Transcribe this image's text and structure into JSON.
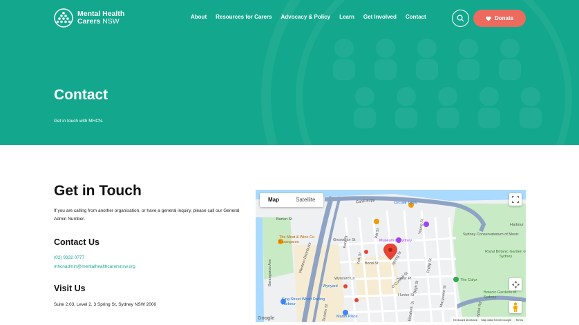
{
  "header": {
    "logo_line1": "Mental Health",
    "logo_line2": "Carers",
    "logo_line2b": "NSW",
    "nav": [
      "About",
      "Resources for Carers",
      "Advocacy & Policy",
      "Learn",
      "Get Involved",
      "Contact"
    ],
    "donate_label": "Donate",
    "search_icon": "search-icon",
    "donate_icon": "heart-icon"
  },
  "hero": {
    "title": "Contact",
    "subtitle": "Get in touch with MHCN."
  },
  "content": {
    "heading": "Get in Touch",
    "intro": "If you are calling from another organisation, or have a general inquiry, please call our General Admin Number.",
    "contact_heading": "Contact Us",
    "phone": "(02) 9332 0777",
    "email": "mhcnadmin@mentalhealthcarersnsw.org",
    "visit_heading": "Visit Us",
    "address": "Suite 2.03, Level 2, 3 Spring St, Sydney NSW 2000"
  },
  "map": {
    "tab_map": "Map",
    "tab_satellite": "Satellite",
    "labels": [
      "Cahill Expy",
      "Circular Quay",
      "Grosvenor St",
      "Bond St",
      "Wynyard",
      "Martin Place",
      "Museum of Sydney",
      "Sydney Conservatorium of Music",
      "Royal Botanic Garden of Sydney",
      "The Calyx",
      "Botanic Gardens of Sydney",
      "The Meat & Wine Co Barangaroo",
      "King Street Wharf Darling Harbour",
      "Western Distributor",
      "Barangaroo Ave",
      "Harbour",
      "Spring St",
      "Pitt St",
      "Phillip St",
      "Macquarie St",
      "Hunter St",
      "Bligh St",
      "Elizabeth St",
      "O'Connell St",
      "Kent St",
      "York St",
      "Young St",
      "Sussex St",
      "Wynyard La",
      "Barton St",
      "Hospital Rd",
      "Farrer Pl"
    ],
    "footer": [
      "Keyboard shortcuts",
      "Map data ©2025 Google",
      "Terms"
    ],
    "google": "Google"
  },
  "colors": {
    "brand_green": "#13a88e",
    "donate_coral": "#ec6b5e",
    "link_green": "#13a88e"
  }
}
